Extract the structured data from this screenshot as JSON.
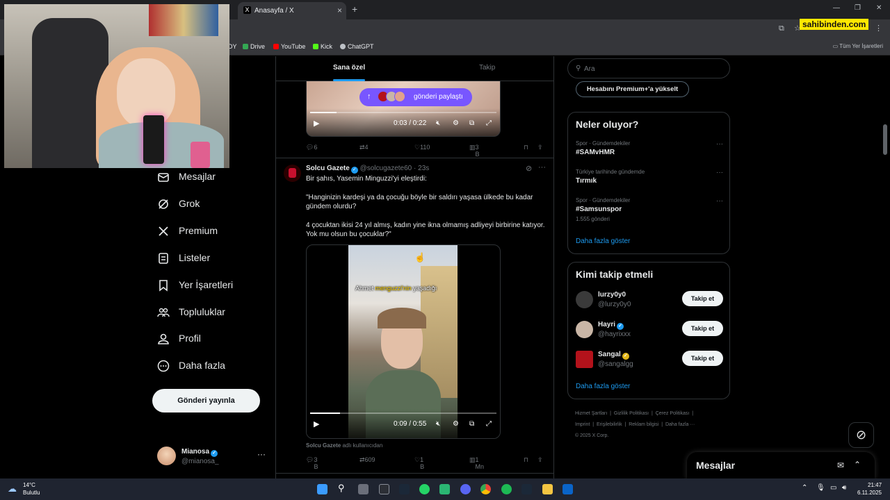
{
  "browser": {
    "tab_title": "Anasayfa / X",
    "tab_favicon": "X",
    "new_tab": "+",
    "sahibinden_badge": "sahibinden.com",
    "bookmarks": [
      {
        "label": "DY",
        "color": "#ffffff"
      },
      {
        "label": "Drive",
        "color": "#34a853"
      },
      {
        "label": "YouTube",
        "color": "#ff0000"
      },
      {
        "label": "Kick",
        "color": "#53fc18"
      },
      {
        "label": "ChatGPT",
        "color": "#bdc1c6"
      }
    ],
    "all_bookmarks": "Tüm Yer İşaretleri"
  },
  "nav": {
    "items": [
      {
        "label": "Mesajlar",
        "icon": "envelope-icon"
      },
      {
        "label": "Grok",
        "icon": "grok-icon"
      },
      {
        "label": "Premium",
        "icon": "x-logo-icon"
      },
      {
        "label": "Listeler",
        "icon": "list-icon"
      },
      {
        "label": "Yer İşaretleri",
        "icon": "bookmark-icon"
      },
      {
        "label": "Topluluklar",
        "icon": "communities-icon"
      },
      {
        "label": "Profil",
        "icon": "person-icon"
      },
      {
        "label": "Daha fazla",
        "icon": "more-circle-icon"
      }
    ],
    "post_button": "Gönderi yayınla",
    "account": {
      "name": "Mianosa",
      "handle": "@mianosa_",
      "more": "···"
    }
  },
  "feed": {
    "tabs": [
      "Sana özel",
      "Takip"
    ],
    "share_pill": "gönderi paylaştı",
    "tweet1": {
      "video_time": "0:03 / 0:22",
      "video_progress": 0.14,
      "replies": "6",
      "reposts": "4",
      "likes": "110",
      "views": "3 B"
    },
    "tweet2": {
      "name": "Solcu Gazete",
      "handle": "@solcugazete60",
      "time": "· 23s",
      "line1": "Bir şahıs, Yasemin Minguzzi'yi eleştirdi:",
      "quote1": "\"Hanginizin kardeşi ya da çocuğu böyle bir saldırı yaşasa ülkede bu kadar gündem olurdu?",
      "quote2": "4 çocuktan ikisi 24 yıl almış, kadın yine ikna olmamış adliyeyi birbirine katıyor. Yok mu olsun bu çocuklar?\"",
      "video_caption_a": "Ahmet ",
      "video_caption_b": "menguzzi'nin",
      "video_caption_c": " yaşadığı",
      "video_time": "0:09 / 0:55",
      "video_progress": 0.16,
      "source_name": "Solcu Gazete",
      "source_suffix": " adlı kullanıcıdan",
      "replies": "3 B",
      "reposts": "609",
      "likes": "1 B",
      "views": "1 Mn"
    }
  },
  "right": {
    "search_placeholder": "Ara",
    "premium_button": "Hesabını Premium+'a yükselt",
    "trends_title": "Neler oluyor?",
    "trends": [
      {
        "category": "Spor · Gündemdekiler",
        "name": "#SAMvHMR",
        "count": ""
      },
      {
        "category": "Türkiye tarihinde gündemde",
        "name": "Tırmık",
        "count": ""
      },
      {
        "category": "Spor · Gündemdekiler",
        "name": "#Samsunspor",
        "count": "1.555 gönderi"
      }
    ],
    "trends_more": "Daha fazla göster",
    "who_title": "Kimi takip etmeli",
    "who": [
      {
        "name": "lurzy0y0",
        "handle": "@lurzy0y0",
        "badge": "",
        "color": "#3a3a3a"
      },
      {
        "name": "Hayri",
        "handle": "@hayrixxx",
        "badge": "blue",
        "color": "#c9b6a6"
      },
      {
        "name": "Sangal",
        "handle": "@sangalgg",
        "badge": "gold",
        "color": "#b3121b"
      }
    ],
    "follow_label": "Takip et",
    "who_more": "Daha fazla göster",
    "footer": [
      "Hizmet Şartları",
      "Gizlilik Politikası",
      "Çerez Politikası",
      "Imprint",
      "Erişilebilirlik",
      "Reklam bilgisi",
      "Daha fazla ···",
      "© 2025 X Corp."
    ],
    "messages_title": "Mesajlar"
  },
  "taskbar": {
    "weather_temp": "14°C",
    "weather_desc": "Bulutlu",
    "time": "21:47",
    "date": "6.11.2025"
  }
}
